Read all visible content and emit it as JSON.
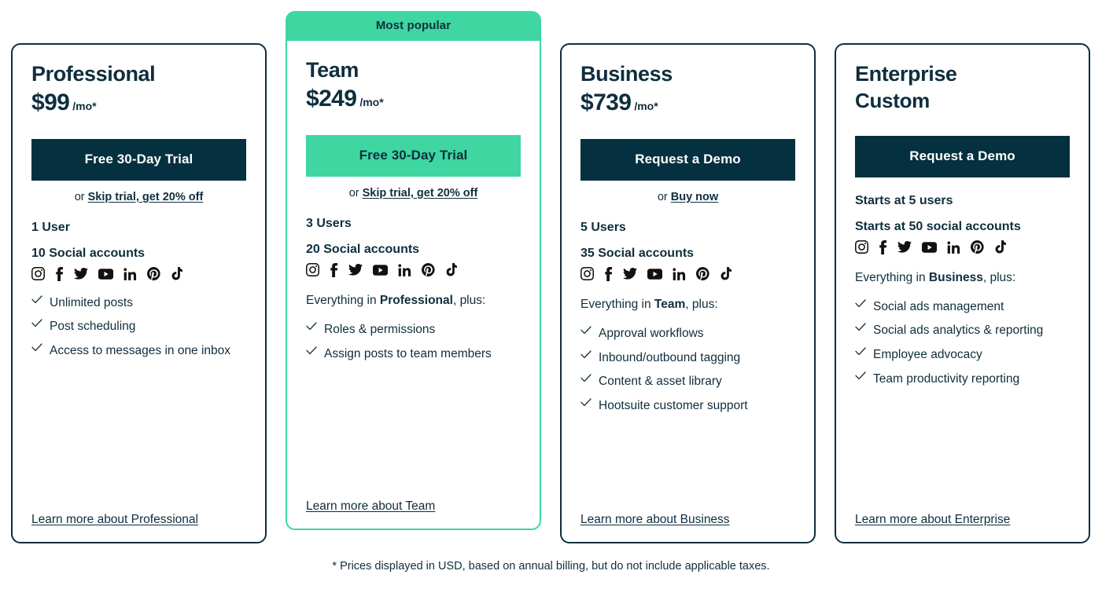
{
  "theme": {
    "dark_navy": "#05303F",
    "text_navy": "#0F2E3E",
    "accent_green": "#3FD6A1",
    "white": "#FFFFFF"
  },
  "badge": {
    "label": "Most popular"
  },
  "social_icons": [
    "instagram-icon",
    "facebook-icon",
    "twitter-icon",
    "youtube-icon",
    "linkedin-icon",
    "pinterest-icon",
    "tiktok-icon"
  ],
  "plans": [
    {
      "id": "professional",
      "name": "Professional",
      "price": "$99",
      "price_suffix": "/mo*",
      "cta_label": "Free 30-Day Trial",
      "cta_style": "dark",
      "or_prefix": "or ",
      "or_link": "Skip trial, get 20% off",
      "specs": [
        "1 User",
        "10 Social accounts"
      ],
      "plus_prefix": "",
      "plus_bold": "",
      "plus_suffix": "",
      "features": [
        "Unlimited posts",
        "Post scheduling",
        "Access to messages in one inbox"
      ],
      "learn_more": "Learn more about Professional"
    },
    {
      "id": "team",
      "name": "Team",
      "price": "$249",
      "price_suffix": "/mo*",
      "cta_label": "Free 30-Day Trial",
      "cta_style": "green",
      "or_prefix": "or ",
      "or_link": "Skip trial, get 20% off",
      "specs": [
        "3 Users",
        "20 Social accounts"
      ],
      "plus_prefix": "Everything in ",
      "plus_bold": "Professional",
      "plus_suffix": ", plus:",
      "features": [
        "Roles & permissions",
        "Assign posts to team members"
      ],
      "learn_more": "Learn more about Team"
    },
    {
      "id": "business",
      "name": "Business",
      "price": "$739",
      "price_suffix": "/mo*",
      "cta_label": "Request a Demo",
      "cta_style": "dark",
      "or_prefix": "or ",
      "or_link": "Buy now",
      "specs": [
        "5 Users",
        "35 Social accounts"
      ],
      "plus_prefix": "Everything in ",
      "plus_bold": "Team",
      "plus_suffix": ", plus:",
      "features": [
        "Approval workflows",
        "Inbound/outbound tagging",
        "Content & asset library",
        "Hootsuite customer support"
      ],
      "learn_more": "Learn more about Business"
    },
    {
      "id": "enterprise",
      "name": "Enterprise",
      "price": "Custom",
      "price_suffix": "",
      "cta_label": "Request a Demo",
      "cta_style": "dark",
      "or_prefix": "",
      "or_link": "",
      "specs": [
        "Starts at 5 users",
        "Starts at 50 social accounts"
      ],
      "plus_prefix": "Everything in ",
      "plus_bold": "Business",
      "plus_suffix": ", plus:",
      "features": [
        "Social ads management",
        "Social ads analytics & reporting",
        "Employee advocacy",
        "Team productivity reporting"
      ],
      "learn_more": "Learn more about Enterprise"
    }
  ],
  "disclaimer": "* Prices displayed in USD, based on annual billing, but do not include applicable taxes."
}
